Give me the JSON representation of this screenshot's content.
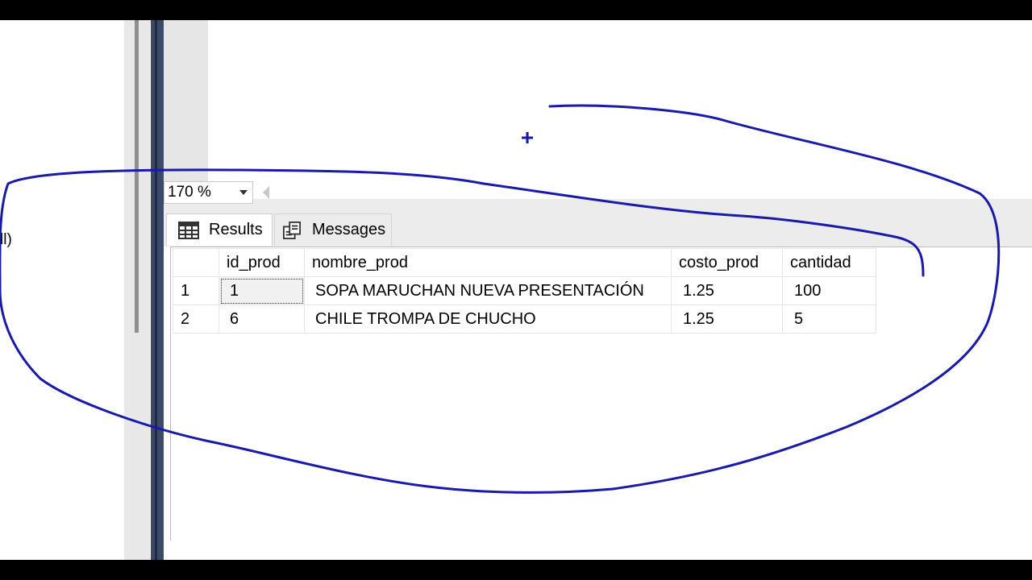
{
  "left_panel": {
    "fragment_text": "ll)"
  },
  "zoom": {
    "value": "170 %"
  },
  "tabs": [
    {
      "label": "Results",
      "icon": "grid-table-icon",
      "active": true
    },
    {
      "label": "Messages",
      "icon": "messages-icon",
      "active": false
    }
  ],
  "grid": {
    "columns": [
      "id_prod",
      "nombre_prod",
      "costo_prod",
      "cantidad"
    ],
    "rows": [
      {
        "num": "1",
        "id_prod": "1",
        "nombre_prod": "SOPA MARUCHAN NUEVA PRESENTACIÓN",
        "costo_prod": "1.25",
        "cantidad": "100"
      },
      {
        "num": "2",
        "id_prod": "6",
        "nombre_prod": "CHILE TROMPA DE CHUCHO",
        "costo_prod": "1.25",
        "cantidad": "5"
      }
    ]
  },
  "annotation": {
    "color": "#1a1aa8",
    "cross_symbol": "+"
  }
}
